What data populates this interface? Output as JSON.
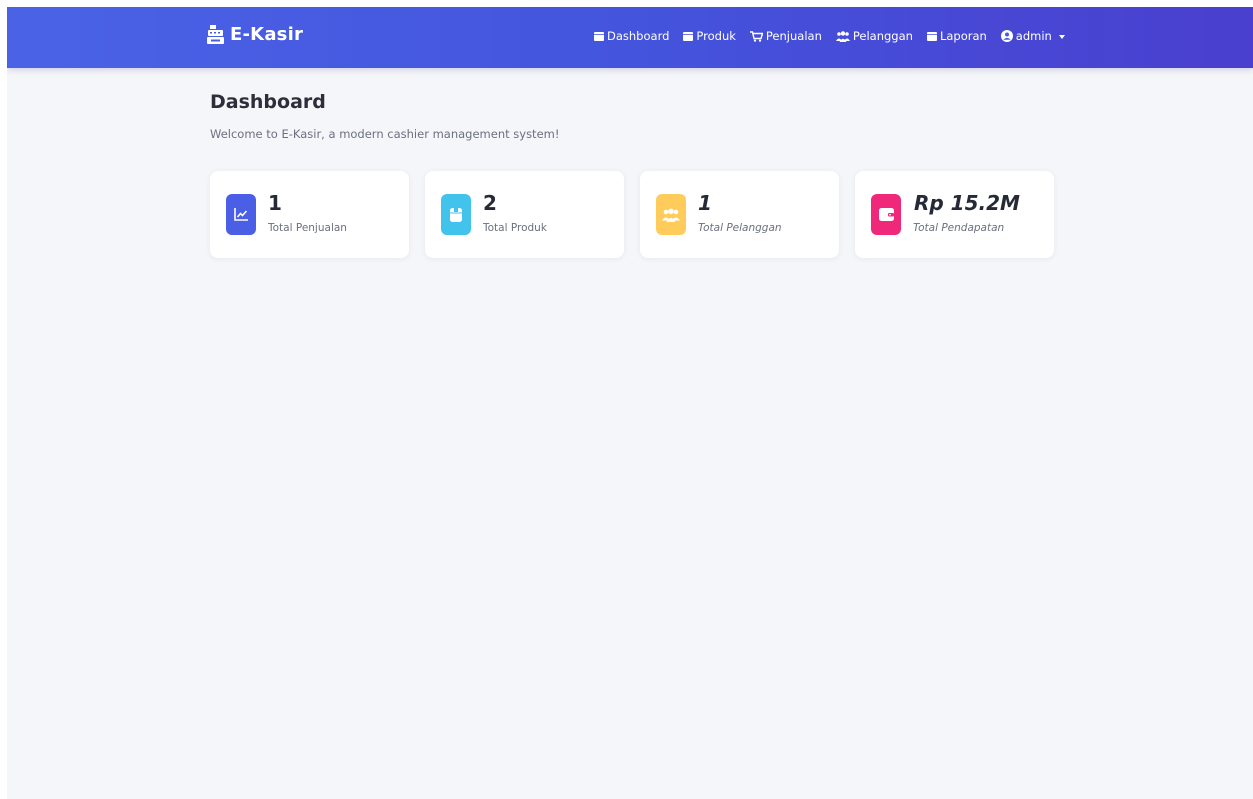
{
  "brand": {
    "name": "E-Kasir",
    "icon": "cash-register-icon"
  },
  "nav": {
    "items": [
      {
        "label": "Dashboard",
        "icon": "calendar-icon"
      },
      {
        "label": "Produk",
        "icon": "calendar-icon"
      },
      {
        "label": "Penjualan",
        "icon": "cart-icon"
      },
      {
        "label": "Pelanggan",
        "icon": "users-icon"
      },
      {
        "label": "Laporan",
        "icon": "calendar-icon"
      }
    ],
    "user": {
      "label": "admin",
      "icon": "user-circle-icon"
    }
  },
  "page": {
    "title": "Dashboard",
    "subtitle": "Welcome to E-Kasir, a modern cashier management system!"
  },
  "stats": [
    {
      "value": "1",
      "label": "Total Penjualan",
      "icon": "chart-line-icon",
      "color": "#4b5fe6"
    },
    {
      "value": "2",
      "label": "Total Produk",
      "icon": "box-icon",
      "color": "#42c3ec"
    },
    {
      "value": "1",
      "label": "Total Pelanggan",
      "icon": "users-icon",
      "color": "#ffcc5c"
    },
    {
      "value": "Rp 15.2M",
      "label": "Total Pendapatan",
      "icon": "wallet-icon",
      "color": "#f0287a"
    }
  ],
  "colors": {
    "navbar_start": "#4a63e6",
    "navbar_end": "#4a3fcf",
    "background": "#f5f6fa"
  }
}
